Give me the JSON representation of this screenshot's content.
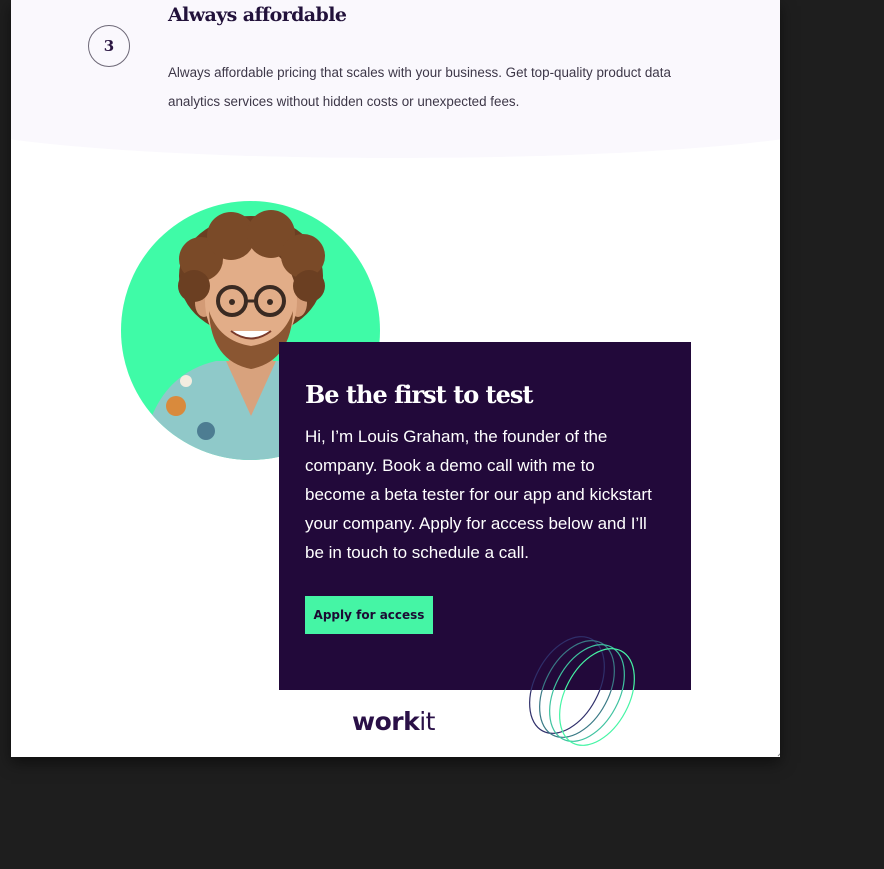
{
  "feature": {
    "step_number": "3",
    "title": "Always affordable",
    "description": "Always affordable pricing that scales with your business. Get top-quality product data analytics services without hidden costs or unexpected fees."
  },
  "cta": {
    "title": "Be the first to test",
    "body": "Hi, I’m Louis Graham, the founder of the company. Book a demo call with me to become a beta tester for our app and kickstart your company. Apply for access below and I’ll be in touch to schedule a call.",
    "button_label": "Apply for access"
  },
  "logo": {
    "part_bold": "work",
    "part_light": "it"
  },
  "colors": {
    "brand_dark": "#22093a",
    "accent_green": "#45f5a5",
    "avatar_bg": "#3ffba7",
    "page_bg": "#ffffff",
    "window_bg": "#1e1e1e"
  },
  "icons": {
    "step_badge": "step-number-badge",
    "avatar": "founder-avatar",
    "rings": "decorative-rings-icon",
    "resize": "resize-grip-icon"
  }
}
